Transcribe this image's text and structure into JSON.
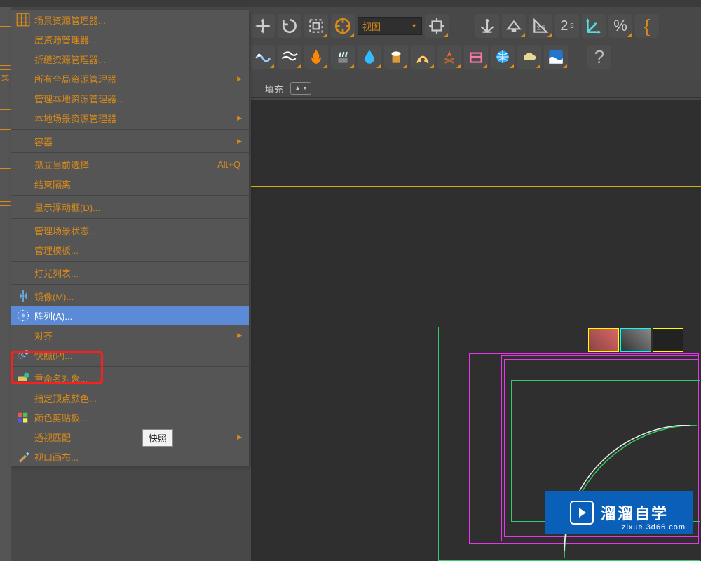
{
  "menu": {
    "items": [
      {
        "label": "场景资源管理器...",
        "icon": "grid-icon",
        "submenu": false
      },
      {
        "label": "层资源管理器...",
        "submenu": false
      },
      {
        "label": "折缝资源管理器...",
        "submenu": false
      },
      {
        "label": "所有全局资源管理器",
        "submenu": true
      },
      {
        "label": "管理本地资源管理器...",
        "submenu": false
      },
      {
        "label": "本地场景资源管理器",
        "submenu": true
      },
      {
        "label": "容器",
        "submenu": true,
        "sep_before": true
      },
      {
        "label": "孤立当前选择",
        "shortcut": "Alt+Q",
        "submenu": false,
        "sep_before": true
      },
      {
        "label": "结束隔离",
        "submenu": false
      },
      {
        "label": "显示浮动框(D)...",
        "submenu": false,
        "sep_before": true
      },
      {
        "label": "管理场景状态...",
        "submenu": false,
        "sep_before": true
      },
      {
        "label": "管理模板...",
        "submenu": false
      },
      {
        "label": "灯光列表...",
        "submenu": false,
        "sep_before": true
      },
      {
        "label": "镜像(M)...",
        "icon": "mirror-icon",
        "submenu": false,
        "sep_before": true
      },
      {
        "label": "阵列(A)...",
        "icon": "array-icon",
        "submenu": false,
        "highlight": true
      },
      {
        "label": "对齐",
        "submenu": true
      },
      {
        "label": "快照(P)...",
        "icon": "snapshot-icon",
        "submenu": false
      },
      {
        "label": "重命名对象...",
        "icon": "rename-icon",
        "submenu": false,
        "sep_before": true
      },
      {
        "label": "指定顶点颜色...",
        "submenu": false
      },
      {
        "label": "颜色剪贴板...",
        "icon": "clipboard-icon",
        "submenu": false
      },
      {
        "label": "透视匹配",
        "submenu": true
      },
      {
        "label": "视口画布...",
        "icon": "brush-icon",
        "submenu": false
      }
    ]
  },
  "tooltip": "快照",
  "toolbar_row1": {
    "select_label": "视图"
  },
  "row3": {
    "label": "填充"
  },
  "left_strip": {
    "t_label": "式"
  },
  "watermark": {
    "title": "溜溜自学",
    "url": "zixue.3d66.com"
  },
  "toolbar_row2_icons": [
    "wave-icon",
    "flow-icon",
    "fire-icon",
    "steam-icon",
    "water-icon",
    "beer-icon",
    "leap-icon",
    "flame-icon",
    "box-icon",
    "globe-icon",
    "cloud-icon",
    "wave2-icon",
    "help-icon"
  ],
  "toolbar_row1_right": [
    "anchor-icon",
    "cube-icon",
    "pin-icon",
    "two-five-icon",
    "axes-icon",
    "percent-icon",
    "brace-icon"
  ],
  "colors": {
    "accent": "#d88a1a",
    "highlight_bg": "#5b8bd6",
    "watermark_bg": "#0a5fb8"
  }
}
